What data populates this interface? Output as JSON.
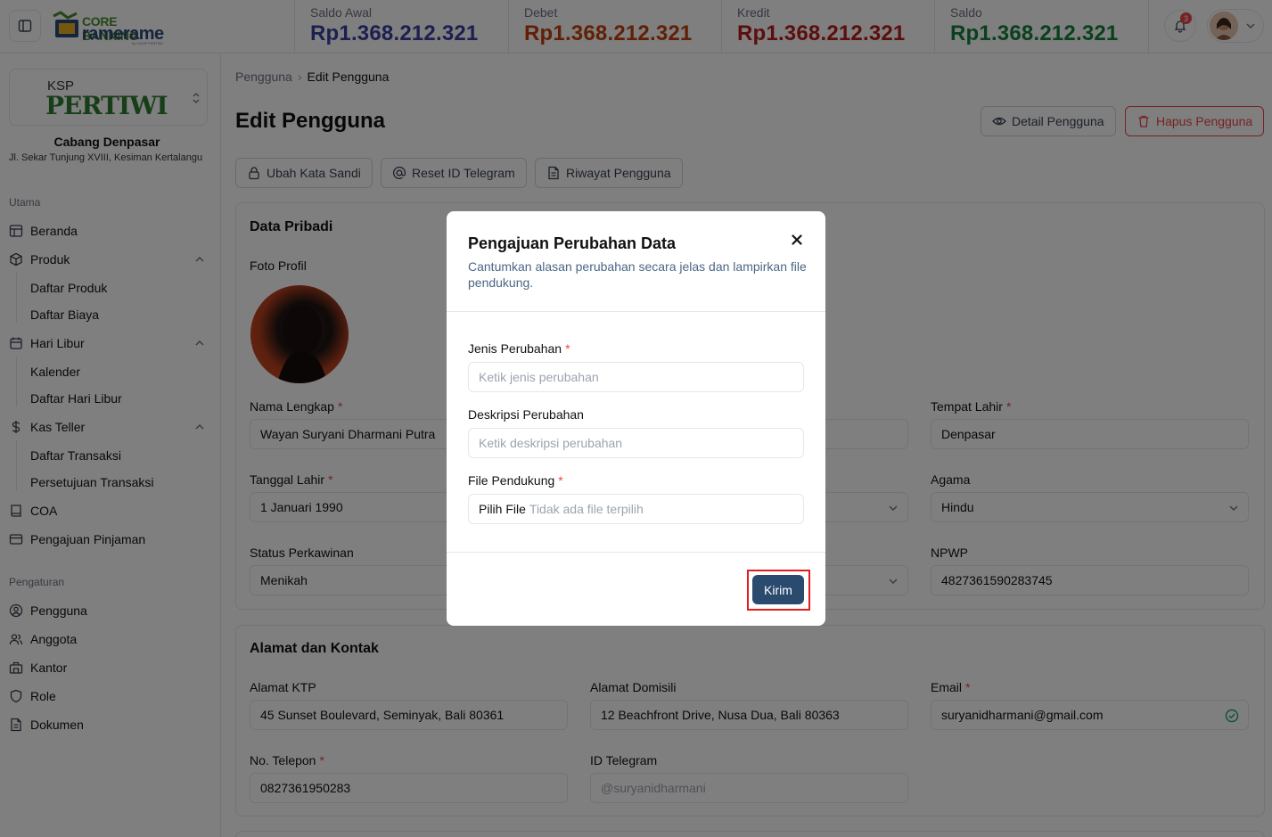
{
  "topbar": {
    "logo_line1": "CORE BANKING",
    "logo_line2": "ramerame",
    "logo_small": "by COOP PERTIWI",
    "stats": [
      {
        "label": "Saldo Awal",
        "value": "Rp1.368.212.321",
        "color": "#3a3fa0"
      },
      {
        "label": "Debet",
        "value": "Rp1.368.212.321",
        "color": "#c2410c"
      },
      {
        "label": "Kredit",
        "value": "Rp1.368.212.321",
        "color": "#b91c1c"
      },
      {
        "label": "Saldo",
        "value": "Rp1.368.212.321",
        "color": "#15803d"
      }
    ],
    "notification_count": "3"
  },
  "sidebar": {
    "org_ksp": "KSP",
    "org_name": "PERTIWI",
    "branch": "Cabang Denpasar",
    "address": "Jl. Sekar Tunjung XVIII, Kesiman Kertalangu",
    "section_main": "Utama",
    "section_settings": "Pengaturan",
    "items": {
      "beranda": "Beranda",
      "produk": "Produk",
      "daftar_produk": "Daftar Produk",
      "daftar_biaya": "Daftar Biaya",
      "hari_libur": "Hari Libur",
      "kalender": "Kalender",
      "daftar_hari_libur": "Daftar Hari Libur",
      "kas_teller": "Kas Teller",
      "daftar_transaksi": "Daftar Transaksi",
      "persetujuan_transaksi": "Persetujuan Transaksi",
      "coa": "COA",
      "pengajuan_pinjaman": "Pengajuan Pinjaman",
      "pengguna": "Pengguna",
      "anggota": "Anggota",
      "kantor": "Kantor",
      "role": "Role",
      "dokumen": "Dokumen"
    }
  },
  "main": {
    "breadcrumb_parent": "Pengguna",
    "breadcrumb_current": "Edit Pengguna",
    "title": "Edit Pengguna",
    "detail_button": "Detail Pengguna",
    "delete_button": "Hapus Pengguna",
    "change_password_button": "Ubah Kata Sandi",
    "reset_telegram_button": "Reset ID Telegram",
    "history_button": "Riwayat Pengguna",
    "personal": {
      "title": "Data Pribadi",
      "photo_label": "Foto Profil",
      "full_name_label": "Nama Lengkap",
      "full_name": "Wayan Suryani Dharmani Putra",
      "birth_place_label": "Tempat Lahir",
      "birth_place": "Denpasar",
      "birth_date_label": "Tanggal Lahir",
      "birth_date": "1 Januari 1990",
      "religion_label": "Agama",
      "religion": "Hindu",
      "marital_label": "Status Perkawinan",
      "marital": "Menikah",
      "npwp_label": "NPWP",
      "npwp": "4827361590283745"
    },
    "address": {
      "title": "Alamat dan Kontak",
      "ktp_label": "Alamat KTP",
      "ktp": "45 Sunset Boulevard, Seminyak, Bali 80361",
      "domisili_label": "Alamat Domisili",
      "domisili": "12 Beachfront Drive, Nusa Dua, Bali 80363",
      "email_label": "Email",
      "email": "suryanidharmani@gmail.com",
      "phone_label": "No. Telepon",
      "phone": "0827361950283",
      "telegram_label": "ID Telegram",
      "telegram_placeholder": "@suryanidharmani"
    }
  },
  "modal": {
    "title": "Pengajuan Perubahan Data",
    "description": "Cantumkan alasan perubahan secara jelas dan lampirkan file pendukung.",
    "type_label": "Jenis Perubahan",
    "type_placeholder": "Ketik jenis perubahan",
    "desc_label": "Deskripsi Perubahan",
    "desc_placeholder": "Ketik deskripsi perubahan",
    "file_label": "File Pendukung",
    "file_button": "Pilih File",
    "file_status": "Tidak ada file terpilih",
    "submit": "Kirim"
  }
}
